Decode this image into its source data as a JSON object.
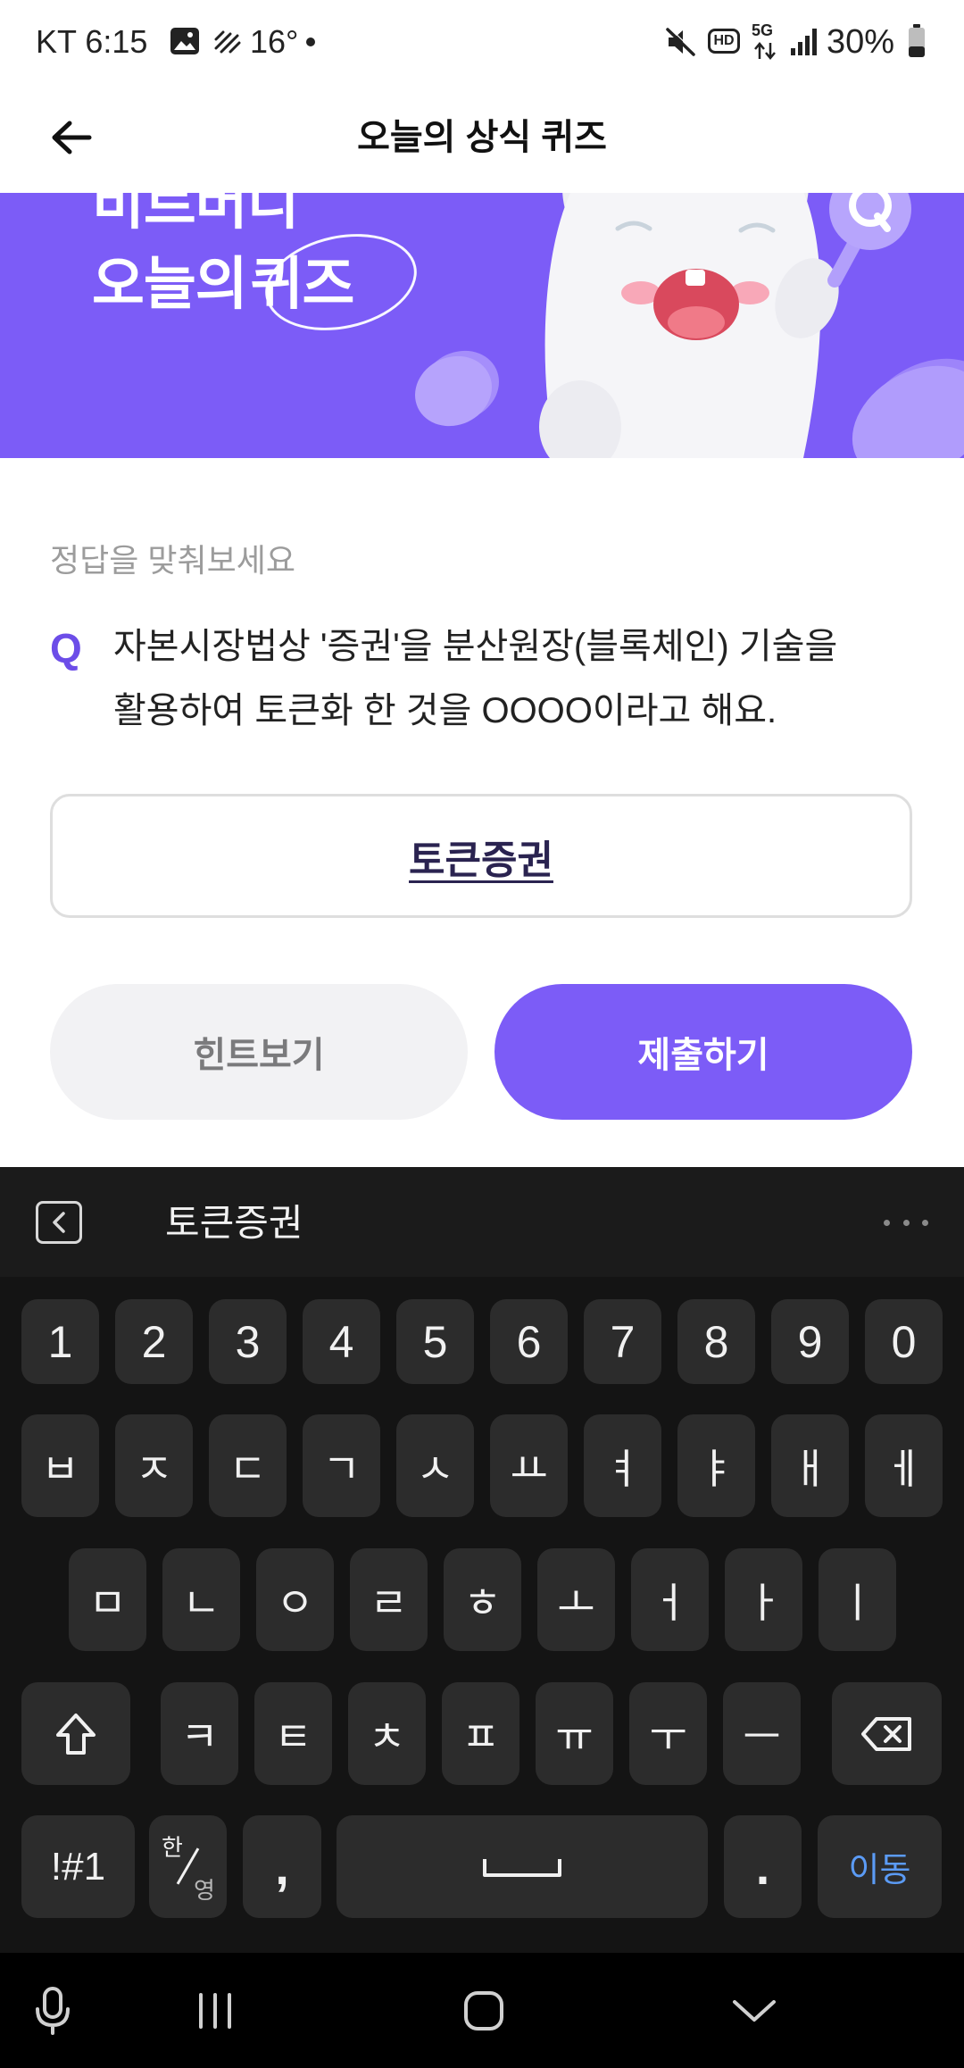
{
  "status_bar": {
    "carrier_time": "KT 6:15",
    "temperature": "16°",
    "hd_label": "HD",
    "network_label": "5G",
    "battery_percent": "30%",
    "icons": [
      "gallery-icon",
      "weather-haze-icon",
      "notification-dot-icon",
      "mute-icon",
      "hd-icon",
      "network-5g-icon",
      "signal-icon",
      "battery-icon"
    ]
  },
  "header": {
    "title": "오늘의 상식 퀴즈",
    "back_icon": "back-arrow-icon"
  },
  "banner": {
    "line1": "비트버디",
    "line2_prefix": "오늘의",
    "line2_highlight": "퀴즈",
    "background_color": "#7c5cf7",
    "illustration": "mascot-with-magnifier"
  },
  "quiz": {
    "prompt": "정답을 맞춰보세요",
    "q_mark": "Q",
    "question_line1": "자본시장법상 '증권'을 분산원장(블록체인) 기술을",
    "question_line2": "활용하여 토큰화 한 것을 OOOO이라고 해요."
  },
  "answer": {
    "value": "토큰증권"
  },
  "buttons": {
    "hint": "힌트보기",
    "submit": "제출하기",
    "submit_color": "#7c5cf7"
  },
  "keyboard": {
    "suggestion": "토큰증권",
    "number_row": [
      "1",
      "2",
      "3",
      "4",
      "5",
      "6",
      "7",
      "8",
      "9",
      "0"
    ],
    "row1": [
      "ㅂ",
      "ㅈ",
      "ㄷ",
      "ㄱ",
      "ㅅ",
      "ㅛ",
      "ㅕ",
      "ㅑ",
      "ㅐ",
      "ㅔ"
    ],
    "row2": [
      "ㅁ",
      "ㄴ",
      "ㅇ",
      "ㄹ",
      "ㅎ",
      "ㅗ",
      "ㅓ",
      "ㅏ",
      "ㅣ"
    ],
    "row3": [
      "ㅋ",
      "ㅌ",
      "ㅊ",
      "ㅍ",
      "ㅠ",
      "ㅜ",
      "ㅡ"
    ],
    "symbols_label": "!#1",
    "lang_top": "한",
    "lang_bottom": "영",
    "comma": ",",
    "period": ".",
    "enter_label": "이동",
    "enter_color": "#5b9bf5"
  },
  "nav_bar": {
    "icons": [
      "microphone-icon",
      "recent-apps-icon",
      "home-icon",
      "hide-keyboard-icon"
    ]
  }
}
